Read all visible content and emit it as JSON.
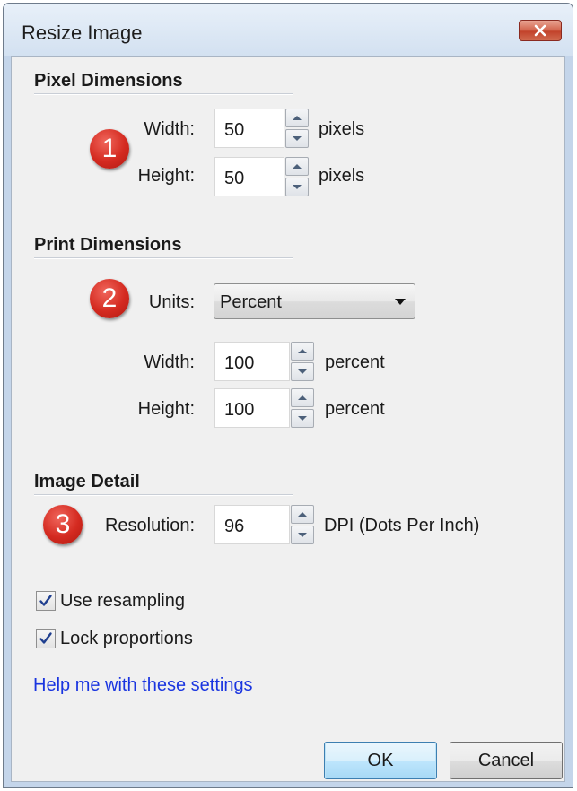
{
  "window": {
    "title": "Resize Image",
    "close_icon": "close-x-icon",
    "close_color": "#c2432b"
  },
  "pixel_dimensions": {
    "heading": "Pixel Dimensions",
    "badge": "1",
    "width": {
      "label": "Width:",
      "value": "50",
      "unit": "pixels"
    },
    "height": {
      "label": "Height:",
      "value": "50",
      "unit": "pixels"
    }
  },
  "print_dimensions": {
    "heading": "Print Dimensions",
    "badge": "2",
    "units": {
      "label": "Units:",
      "selected": "Percent"
    },
    "width": {
      "label": "Width:",
      "value": "100",
      "unit": "percent"
    },
    "height": {
      "label": "Height:",
      "value": "100",
      "unit": "percent"
    }
  },
  "image_detail": {
    "heading": "Image Detail",
    "badge": "3",
    "resolution": {
      "label": "Resolution:",
      "value": "96",
      "unit": "DPI (Dots Per Inch)"
    }
  },
  "options": {
    "use_resampling": {
      "label": "Use resampling",
      "checked": true
    },
    "lock_proportions": {
      "label": "Lock proportions",
      "checked": true
    }
  },
  "help_link": "Help me with these settings",
  "buttons": {
    "ok": "OK",
    "cancel": "Cancel"
  },
  "colors": {
    "link": "#1a35e0",
    "badge": "#d42a20",
    "ok_border": "#3c7fb1"
  }
}
